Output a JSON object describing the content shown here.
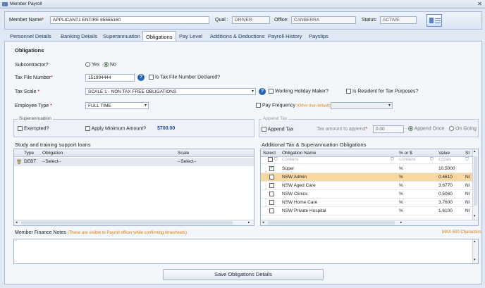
{
  "window": {
    "title": "Member Payroll"
  },
  "header": {
    "member_name_label": "Member Name",
    "member_name_value": "APPLICANT1 ENTIRE 65555160",
    "qual_label": "Qual :",
    "qual_value": "DRIVER",
    "office_label": "Office:",
    "office_value": "CANBERRA",
    "status_label": "Status:",
    "status_value": "ACTIVE"
  },
  "tabs": [
    {
      "label": "Personnel Details"
    },
    {
      "label": "Banking Details"
    },
    {
      "label": "Superannuation"
    },
    {
      "label": "Obligations"
    },
    {
      "label": "Pay Level"
    },
    {
      "label": "Additions & Deductions"
    },
    {
      "label": "Payroll History"
    },
    {
      "label": "Payslips"
    }
  ],
  "obligations": {
    "section_title": "Obligations",
    "subcontractor_label": "Subcontractor?",
    "yes_label": "Yes",
    "no_label": "No",
    "tfn_label": "Tax File Number",
    "tfn_value": "151994444",
    "tfn_declared_label": "Is Tax File Number Declared?",
    "tax_scale_label": "Tax Scale",
    "tax_scale_value": "SCALE 1 - NON TAX FREE OBLIGATIONS",
    "working_holiday_label": "Working Holiday Maker?",
    "resident_label": "Is Resident for Tax Purposes?",
    "employee_type_label": "Employee Type",
    "employee_type_value": "FULL TIME",
    "pay_frequency_label": "Pay Frequency",
    "pay_frequency_hint": "(Other than default)"
  },
  "superannuation": {
    "group_title": "Superannuation",
    "exempted_label": "Exempted?",
    "apply_min_label": "Apply Minimum Amount?",
    "min_amount": "$700.00"
  },
  "append_tax": {
    "group_title": "Append Tax",
    "append_label": "Append Tax",
    "amount_label": "Tax amount to append",
    "amount_value": "0.00",
    "once_label": "Append Once",
    "ongoing_label": "On Going"
  },
  "loans": {
    "title": "Study and training support loans",
    "columns": [
      "Type",
      "Obligation",
      "Scale"
    ],
    "rows": [
      {
        "type": "DEBT",
        "obligation": "--Select--",
        "scale": "--Select--"
      }
    ]
  },
  "additional": {
    "title": "Additional Tax & Superannuation Obligations",
    "columns": [
      "Select",
      "Obligation Name",
      "% or $",
      "Value",
      "St"
    ],
    "filters": [
      "Contains",
      "Contains",
      "Equals"
    ],
    "rows": [
      {
        "checked": true,
        "name": "Super",
        "unit": "%",
        "value": "10.5000",
        "st": ""
      },
      {
        "checked": false,
        "name": "NSW Admin",
        "unit": "%",
        "value": "0.4610",
        "st": "NI"
      },
      {
        "checked": false,
        "name": "NSW Aged Care",
        "unit": "%",
        "value": "3.6770",
        "st": "NI"
      },
      {
        "checked": false,
        "name": "NSW Clinics",
        "unit": "%",
        "value": "0.5060",
        "st": "NI"
      },
      {
        "checked": false,
        "name": "NSW Home Care",
        "unit": "%",
        "value": "3.7600",
        "st": "NI"
      },
      {
        "checked": false,
        "name": "NSW Private Hospital",
        "unit": "%",
        "value": "1.6100",
        "st": "NI"
      }
    ]
  },
  "notes": {
    "label": "Member Finance Notes",
    "hint": "(These are visible to Payroll officer while confirming timesheets)",
    "max": "MAX 500 Characters"
  },
  "save_button": "Save Obligations Details"
}
